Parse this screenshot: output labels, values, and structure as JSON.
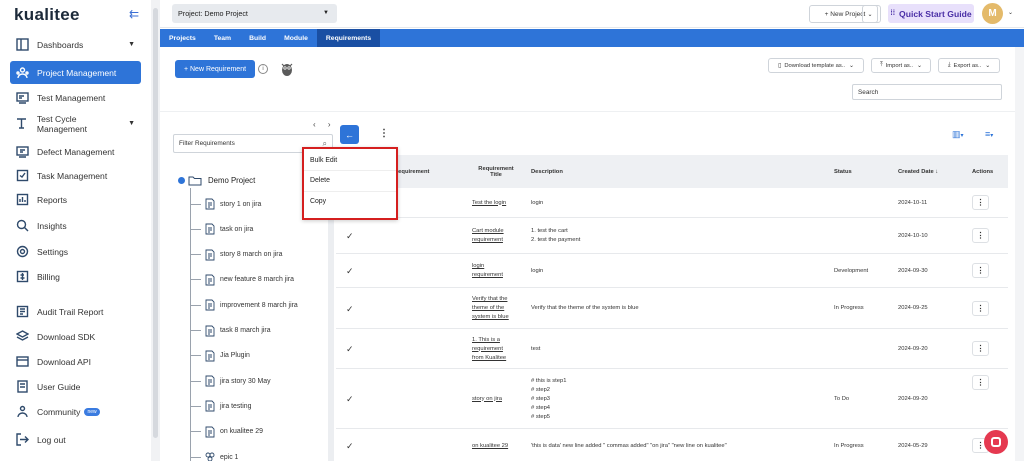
{
  "app": {
    "logo": "kualitee",
    "collapse_icon": "collapse-icon"
  },
  "sidebar": {
    "items": [
      {
        "label": "Dashboards",
        "icon": "dashboard-icon",
        "caret": true
      },
      {
        "label": "Project Management",
        "icon": "project-icon",
        "active": true
      },
      {
        "label": "Test Management",
        "icon": "test-icon"
      },
      {
        "label": "Test Cycle Management",
        "icon": "cycle-icon",
        "caret": true
      },
      {
        "label": "Defect Management",
        "icon": "defect-icon"
      },
      {
        "label": "Task Management",
        "icon": "task-icon"
      },
      {
        "label": "Reports",
        "icon": "reports-icon"
      },
      {
        "label": "Insights",
        "icon": "insights-icon"
      },
      {
        "label": "Settings",
        "icon": "settings-icon"
      },
      {
        "label": "Billing",
        "icon": "billing-icon"
      },
      {
        "label": "Audit Trail Report",
        "icon": "audit-icon"
      },
      {
        "label": "Download SDK",
        "icon": "sdk-icon"
      },
      {
        "label": "Download API",
        "icon": "api-icon"
      },
      {
        "label": "User Guide",
        "icon": "guide-icon"
      },
      {
        "label": "Community",
        "icon": "community-icon",
        "badge": "new"
      },
      {
        "label": "Log out",
        "icon": "logout-icon"
      }
    ]
  },
  "topbar": {
    "project_label": "Project:",
    "project_value": "Demo Project",
    "new_project": "+ New Project",
    "quick_start": "Quick Start Guide",
    "avatar_initial": "M"
  },
  "tabs": [
    {
      "label": "Projects"
    },
    {
      "label": "Team"
    },
    {
      "label": "Build"
    },
    {
      "label": "Module"
    },
    {
      "label": "Requirements",
      "active": true
    }
  ],
  "toolbar": {
    "new_requirement": "+ New Requirement",
    "download_template": "Download template as..",
    "import_as": "Import as..",
    "export_as": "Export as..",
    "search_placeholder": "Search"
  },
  "filter": {
    "placeholder": "Filter Requirements"
  },
  "tree": {
    "root": "Demo Project",
    "nodes": [
      "story 1 on jira",
      "task on jira",
      "story 8 march on jira",
      "new feature 8 march jira",
      "improvement 8 march jira",
      "task 8 march jira",
      "Jia Plugin",
      "jira story 30 May",
      "jira testing",
      "on kualitee 29",
      "epic 1"
    ]
  },
  "context_menu": {
    "items": [
      "Bulk Edit",
      "Delete",
      "Copy"
    ]
  },
  "table": {
    "headers": {
      "requirement": "Requirement",
      "req_title": "Requirement Title",
      "description": "Description",
      "status": "Status",
      "created_date": "Created Date ↓",
      "actions": "Actions"
    },
    "rows": [
      {
        "title": [
          "Test the login"
        ],
        "desc": [
          "login"
        ],
        "status": "",
        "date": "2024-10-11"
      },
      {
        "title": [
          "Cart module",
          "requirement"
        ],
        "desc": [
          "1. test the cart",
          "2. test the payment"
        ],
        "status": "",
        "date": "2024-10-10"
      },
      {
        "title": [
          "login",
          "requirement"
        ],
        "desc": [
          "login"
        ],
        "status": "Development",
        "date": "2024-09-30"
      },
      {
        "title": [
          "Verify that the",
          "theme of the",
          "system is blue"
        ],
        "desc": [
          "Verify that the theme of the system is blue"
        ],
        "status": "In Progress",
        "date": "2024-09-25"
      },
      {
        "title": [
          "1. This is a",
          "requirement",
          "from Kualitee"
        ],
        "desc": [
          "test"
        ],
        "status": "",
        "date": "2024-09-20"
      },
      {
        "title": [
          "story on jira"
        ],
        "desc": [
          "# this is step1",
          "# step2",
          "# step3",
          "# step4",
          "# step5"
        ],
        "status": "To Do",
        "date": "2024-09-20"
      },
      {
        "title": [
          "on kualitee 29"
        ],
        "desc": [
          "'this is data' new line added \" commas added\" \"on jira\" \"new line on kualitee\""
        ],
        "status": "In Progress",
        "date": "2024-05-29"
      }
    ]
  }
}
